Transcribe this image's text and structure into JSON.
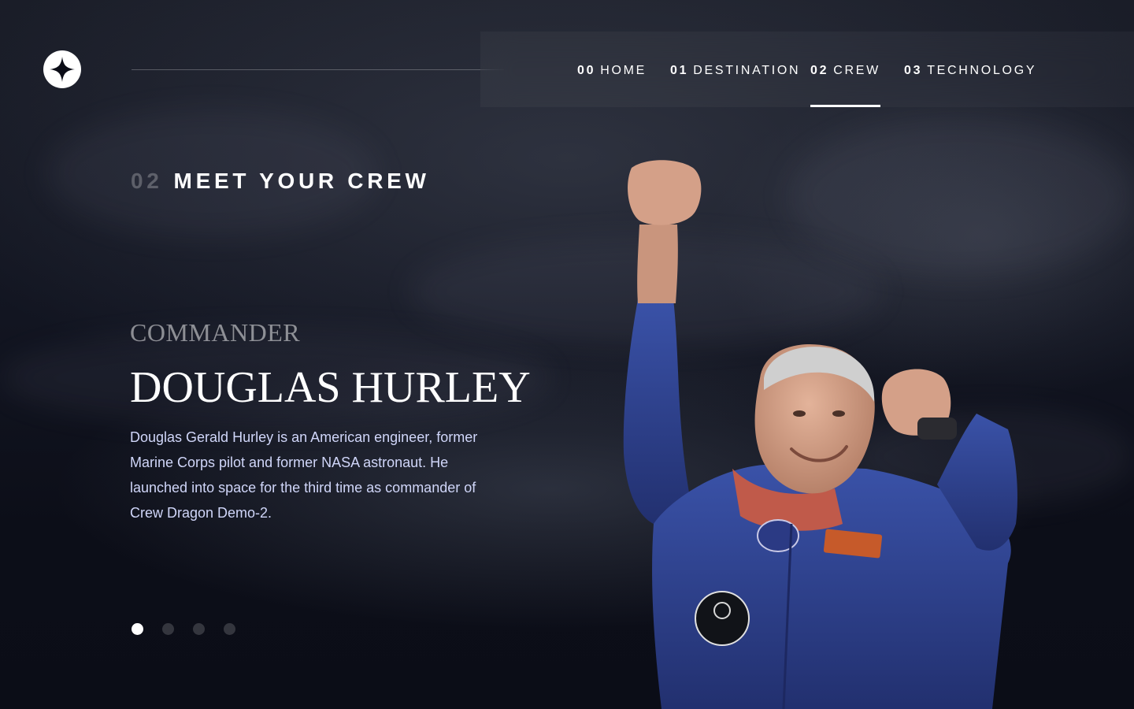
{
  "nav": {
    "items": [
      {
        "num": "00",
        "label": "HOME"
      },
      {
        "num": "01",
        "label": "DESTINATION"
      },
      {
        "num": "02",
        "label": "CREW"
      },
      {
        "num": "03",
        "label": "TECHNOLOGY"
      }
    ],
    "active_index": 2
  },
  "page": {
    "number": "02",
    "title": "MEET YOUR CREW"
  },
  "crew": {
    "role": "COMMANDER",
    "name": "DOUGLAS HURLEY",
    "bio": "Douglas Gerald Hurley is an American engineer, former Marine Corps pilot and former NASA astronaut. He launched into space for the third time as commander of Crew Dragon Demo-2."
  },
  "pagination": {
    "count": 4,
    "active_index": 0
  },
  "colors": {
    "background": "#0b0d17",
    "text": "#ffffff",
    "body_text": "#d0d6f9",
    "suit": "#2b3f8f"
  },
  "icons": {
    "logo": "star-logo-icon"
  }
}
